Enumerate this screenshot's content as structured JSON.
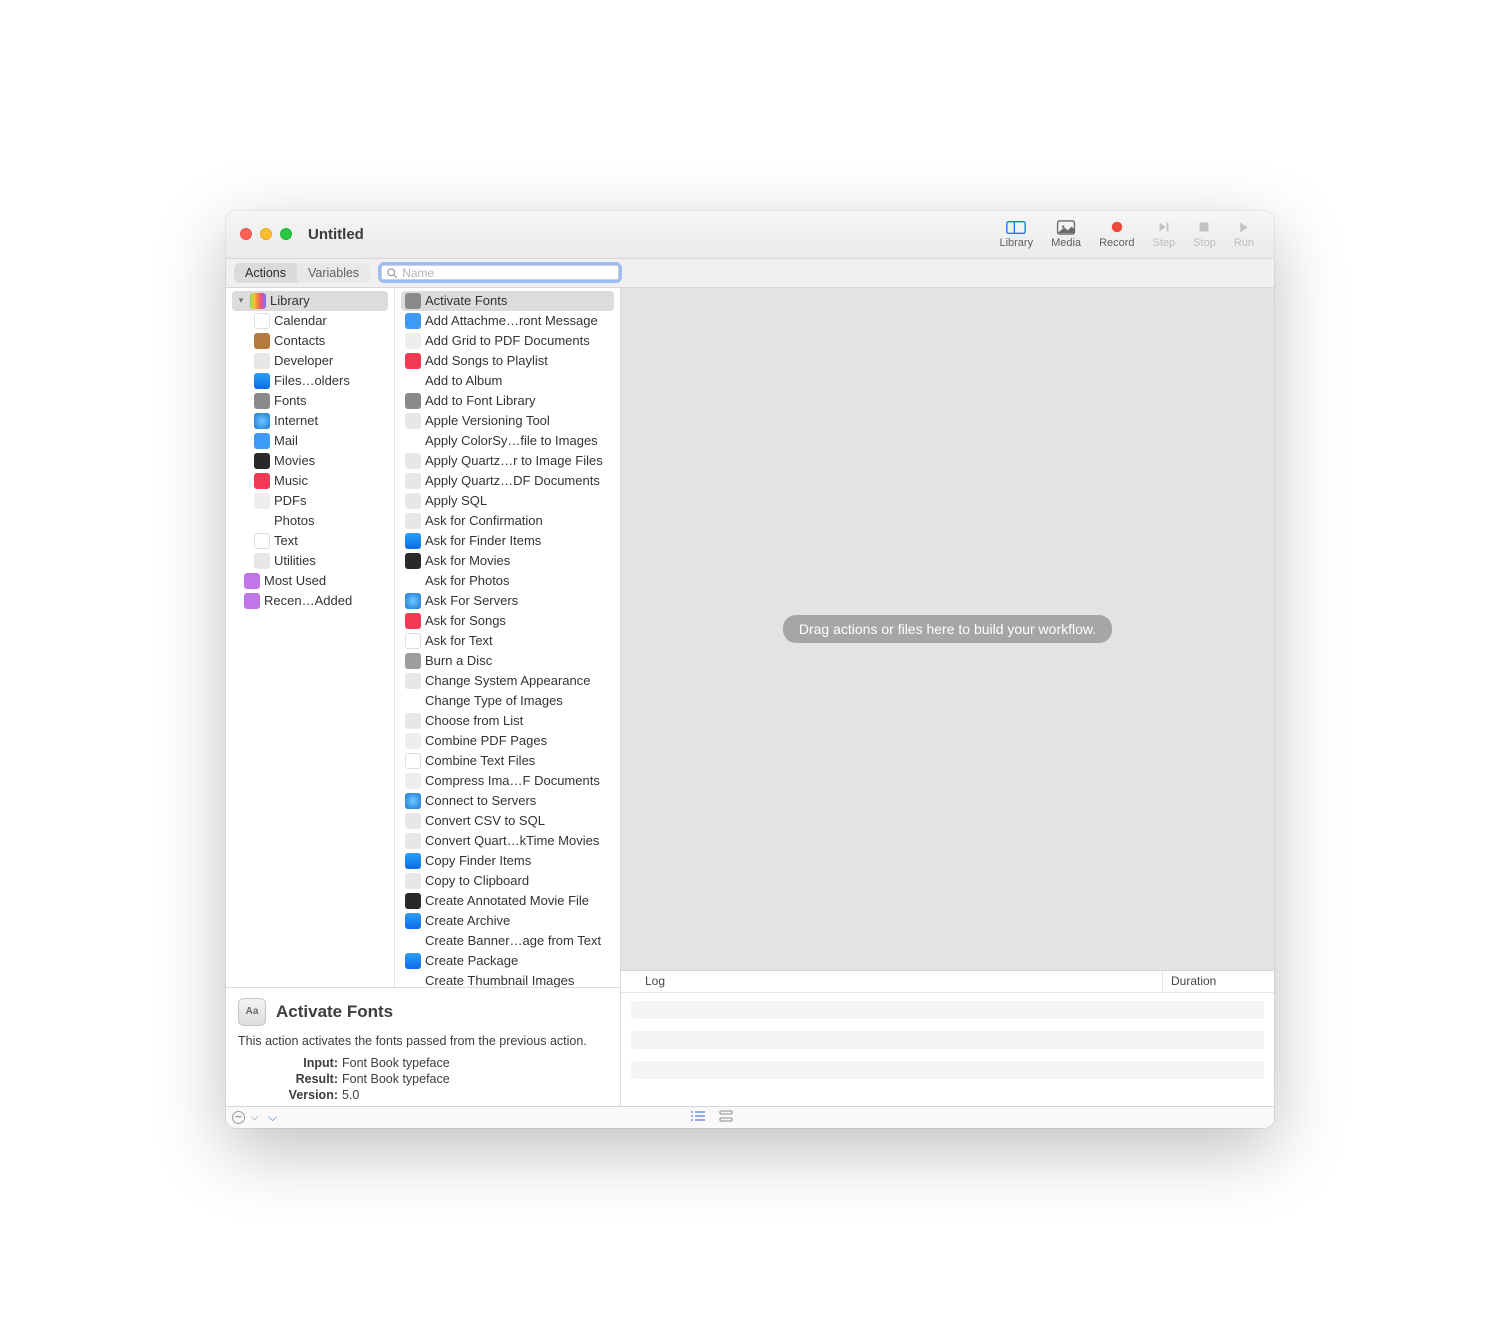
{
  "window": {
    "title": "Untitled"
  },
  "toolbar": {
    "library": "Library",
    "media": "Media",
    "record": "Record",
    "step": "Step",
    "stop": "Stop",
    "run": "Run"
  },
  "secondbar": {
    "actions": "Actions",
    "variables": "Variables",
    "search_placeholder": "Name"
  },
  "library": {
    "root": "Library",
    "categories": [
      "Calendar",
      "Contacts",
      "Developer",
      "Files…olders",
      "Fonts",
      "Internet",
      "Mail",
      "Movies",
      "Music",
      "PDFs",
      "Photos",
      "Text",
      "Utilities"
    ],
    "smart": [
      "Most Used",
      "Recen…Added"
    ]
  },
  "actions": [
    "Activate Fonts",
    "Add Attachme…ront Message",
    "Add Grid to PDF Documents",
    "Add Songs to Playlist",
    "Add to Album",
    "Add to Font Library",
    "Apple Versioning Tool",
    "Apply ColorSy…file to Images",
    "Apply Quartz…r to Image Files",
    "Apply Quartz…DF Documents",
    "Apply SQL",
    "Ask for Confirmation",
    "Ask for Finder Items",
    "Ask for Movies",
    "Ask for Photos",
    "Ask For Servers",
    "Ask for Songs",
    "Ask for Text",
    "Burn a Disc",
    "Change System Appearance",
    "Change Type of Images",
    "Choose from List",
    "Combine PDF Pages",
    "Combine Text Files",
    "Compress Ima…F Documents",
    "Connect to Servers",
    "Convert CSV to SQL",
    "Convert Quart…kTime Movies",
    "Copy Finder Items",
    "Copy to Clipboard",
    "Create Annotated Movie File",
    "Create Archive",
    "Create Banner…age from Text",
    "Create Package",
    "Create Thumbnail Images"
  ],
  "action_icons": [
    "fonts",
    "mail",
    "pdf",
    "music",
    "photos",
    "fonts",
    "dev",
    "photos",
    "util",
    "util",
    "util",
    "util",
    "finder",
    "movies",
    "photos",
    "internet",
    "music",
    "text",
    "burn",
    "dev",
    "photos",
    "util",
    "pdf",
    "text",
    "pdf",
    "internet",
    "util",
    "util",
    "finder",
    "util",
    "movies",
    "finder",
    "photos",
    "finder",
    "photos"
  ],
  "canvas_hint": "Drag actions or files here to build your workflow.",
  "log": {
    "log_label": "Log",
    "duration_label": "Duration"
  },
  "description": {
    "title": "Activate Fonts",
    "text": "This action activates the fonts passed from the previous action.",
    "input_k": "Input:",
    "input_v": "Font Book typeface",
    "result_k": "Result:",
    "result_v": "Font Book typeface",
    "version_k": "Version:",
    "version_v": "5.0"
  }
}
